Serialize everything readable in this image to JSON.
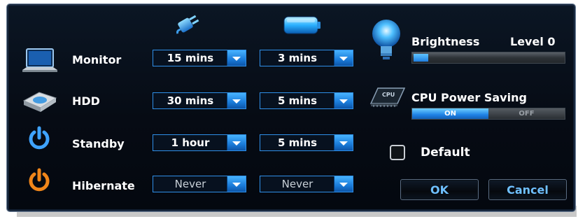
{
  "columns": {
    "plugged_icon": "power-plug-icon",
    "battery_icon": "battery-icon"
  },
  "rows": [
    {
      "icon": "laptop-icon",
      "label": "Monitor",
      "ac": "15 mins",
      "battery": "3 mins"
    },
    {
      "icon": "hdd-icon",
      "label": "HDD",
      "ac": "30 mins",
      "battery": "5 mins"
    },
    {
      "icon": "power-icon",
      "label": "Standby",
      "ac": "1 hour",
      "battery": "5 mins"
    },
    {
      "icon": "power-orange-icon",
      "label": "Hibernate",
      "ac": "Never",
      "battery": "Never"
    }
  ],
  "brightness": {
    "icon": "lightbulb-icon",
    "label": "Brightness",
    "level": "Level 0",
    "fraction": 0.1
  },
  "cpu": {
    "icon": "cpu-icon",
    "chip_text": "CPU",
    "label": "CPU Power Saving",
    "on": "ON",
    "off": "OFF",
    "state": "on"
  },
  "default_label": "Default",
  "buttons": {
    "ok": "OK",
    "cancel": "Cancel"
  },
  "colors": {
    "accent": "#2f8fe8",
    "panel": "#060b14",
    "button_text": "#6fc0ff",
    "hibernate_icon": "#f0861a"
  }
}
